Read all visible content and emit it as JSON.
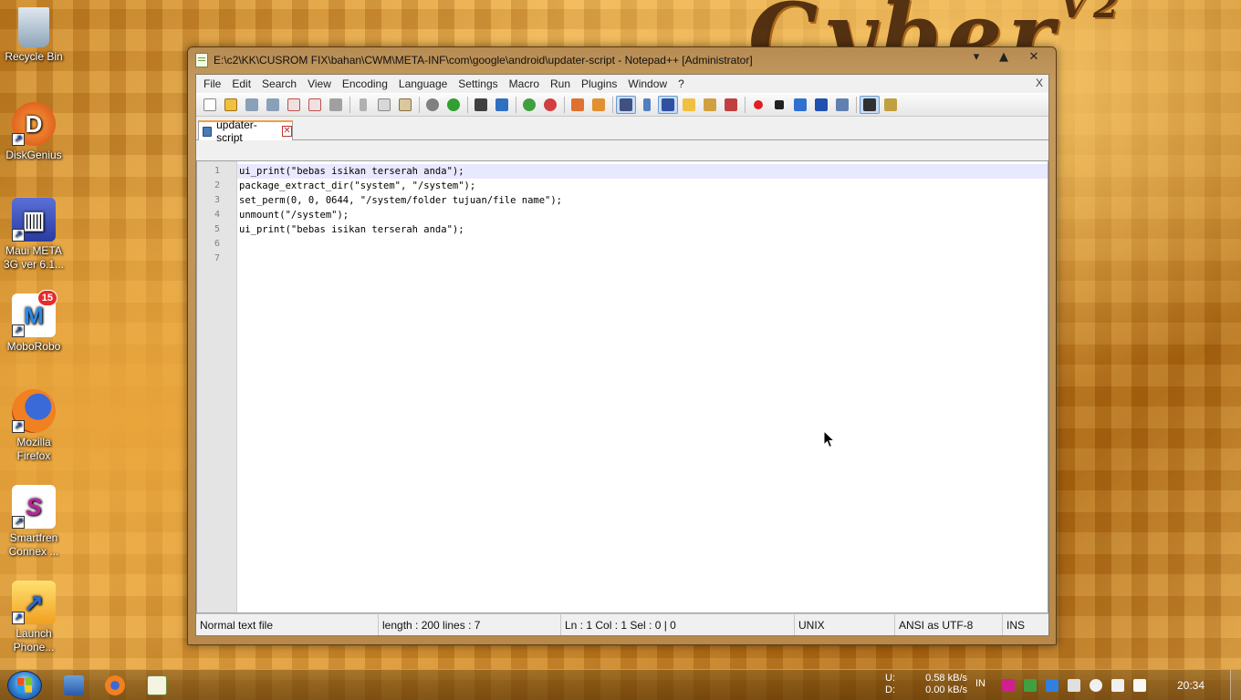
{
  "desktop": {
    "icons": [
      {
        "label": "Recycle Bin",
        "icon": "recycle-bin-icon"
      },
      {
        "label": "DiskGenius",
        "icon": "diskgenius-icon"
      },
      {
        "label": "Maui META 3G ver 6.1...",
        "icon": "maui-meta-icon"
      },
      {
        "label": "MoboRobo",
        "icon": "moborobo-icon",
        "badge": "15"
      },
      {
        "label": "Mozilla Firefox",
        "icon": "firefox-icon"
      },
      {
        "label": "Smartfren Connex ...",
        "icon": "smartfren-icon"
      },
      {
        "label": "Launch Phone...",
        "icon": "launch-phone-icon"
      }
    ],
    "wallpaper_text": "Cyber",
    "wallpaper_suffix": "V2"
  },
  "window": {
    "title": "E:\\c2\\KK\\CUSROM FIX\\bahan\\CWM\\META-INF\\com\\google\\android\\updater-script - Notepad++ [Administrator]",
    "controls": {
      "minimize": "▾",
      "maximize": "▲",
      "close": "✕"
    }
  },
  "menu": {
    "items": [
      "File",
      "Edit",
      "Search",
      "View",
      "Encoding",
      "Language",
      "Settings",
      "Macro",
      "Run",
      "Plugins",
      "Window",
      "?"
    ],
    "close": "X"
  },
  "toolbar": {
    "buttons": [
      "new-file",
      "open-file",
      "save",
      "save-all",
      "close",
      "close-all",
      "print",
      "|",
      "cut",
      "copy",
      "paste",
      "|",
      "undo",
      "redo",
      "|",
      "find",
      "replace",
      "|",
      "zoom-in",
      "zoom-out",
      "|",
      "sync-vertical",
      "sync-horizontal",
      "|",
      "word-wrap",
      "show-all-chars",
      "indent-guide",
      "user-language",
      "doc-map",
      "function-list",
      "|",
      "record-macro",
      "stop-record",
      "play-macro",
      "run-macro-multiple",
      "save-macro",
      "|",
      "spell-check",
      "spell-options"
    ]
  },
  "tabs": [
    {
      "label": "updater-script",
      "close": "✕"
    }
  ],
  "editor": {
    "lines": [
      "ui_print(\"bebas isikan terserah anda\");",
      "package_extract_dir(\"system\", \"/system\");",
      "set_perm(0, 0, 0644, \"/system/folder tujuan/file name\");",
      "unmount(\"/system\");",
      "ui_print(\"bebas isikan terserah anda\");",
      "",
      ""
    ],
    "line_numbers": [
      "1",
      "2",
      "3",
      "4",
      "5",
      "6",
      "7"
    ]
  },
  "status": {
    "file_type": "Normal text file",
    "length": "length : 200    lines : 7",
    "position": "Ln : 1    Col : 1    Sel : 0 | 0",
    "eol": "UNIX",
    "encoding": "ANSI as UTF-8",
    "mode": "INS"
  },
  "taskbar": {
    "net_upload_label": "U:",
    "net_upload": "0.58 kB/s",
    "net_download_label": "D:",
    "net_download": "0.00 kB/s",
    "language": "IN",
    "clock": "20:34"
  }
}
